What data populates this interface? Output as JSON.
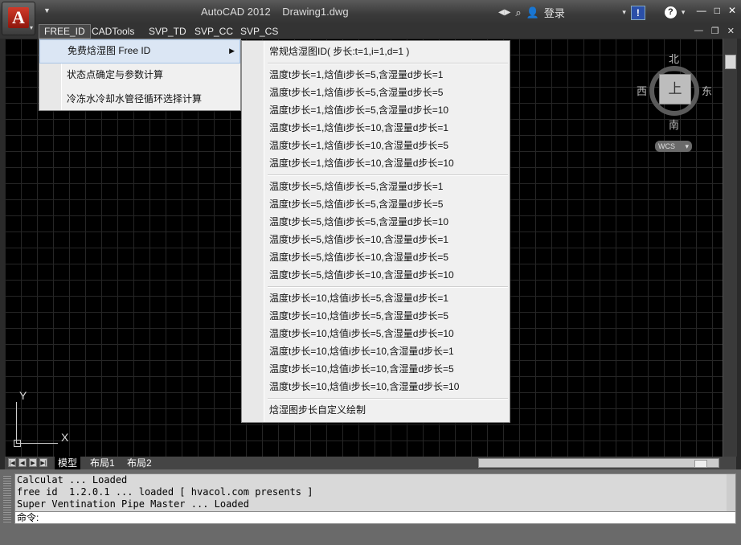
{
  "titlebar": {
    "app": "AutoCAD 2012",
    "document": "Drawing1.dwg",
    "login_label": "登录",
    "help_box": "!",
    "help_question": "?",
    "winctl": [
      "—",
      "□",
      "✕"
    ]
  },
  "menubar": {
    "items": [
      "FREE_ID",
      "CADTools",
      "SVP_TD",
      "SVP_CC",
      "SVP_CS"
    ],
    "mdi_ctl": [
      "—",
      "❐",
      "✕"
    ]
  },
  "menu1": {
    "items": [
      "免费焓湿图  Free ID",
      "状态点确定与参数计算",
      "冷冻水冷却水管径循环选择计算"
    ]
  },
  "menu2": {
    "header": "常规焓湿图ID( 步长:t=1,i=1,d=1 )",
    "group1": [
      "温度t步长=1,焓值i步长=5,含湿量d步长=1",
      "温度t步长=1,焓值i步长=5,含湿量d步长=5",
      "温度t步长=1,焓值i步长=5,含湿量d步长=10",
      "温度t步长=1,焓值i步长=10,含湿量d步长=1",
      "温度t步长=1,焓值i步长=10,含湿量d步长=5",
      "温度t步长=1,焓值i步长=10,含湿量d步长=10"
    ],
    "group2": [
      "温度t步长=5,焓值i步长=5,含湿量d步长=1",
      "温度t步长=5,焓值i步长=5,含湿量d步长=5",
      "温度t步长=5,焓值i步长=5,含湿量d步长=10",
      "温度t步长=5,焓值i步长=10,含湿量d步长=1",
      "温度t步长=5,焓值i步长=10,含湿量d步长=5",
      "温度t步长=5,焓值i步长=10,含湿量d步长=10"
    ],
    "group3": [
      "温度t步长=10,焓值i步长=5,含湿量d步长=1",
      "温度t步长=10,焓值i步长=5,含湿量d步长=5",
      "温度t步长=10,焓值i步长=5,含湿量d步长=10",
      "温度t步长=10,焓值i步长=10,含湿量d步长=1",
      "温度t步长=10,焓值i步长=10,含湿量d步长=5",
      "温度t步长=10,焓值i步长=10,含湿量d步长=10"
    ],
    "footer": "焓湿图步长自定义绘制"
  },
  "viewcube": {
    "north": "北",
    "south": "南",
    "west": "西",
    "east": "东",
    "face": "上",
    "wcs": "WCS"
  },
  "ucs": {
    "x": "X",
    "y": "Y"
  },
  "layout_tabs": [
    "模型",
    "布局1",
    "布局2"
  ],
  "command": {
    "history": [
      "Calculat ... Loaded",
      "free id  1.2.0.1 ... loaded [ hvacol.com presents ]",
      "Super Ventination Pipe Master ... Loaded"
    ],
    "prompt": "命令:"
  },
  "colors": {
    "menu_bg": "#f0f0f0",
    "highlight": "#dbe6f4",
    "canvas": "#000000"
  }
}
